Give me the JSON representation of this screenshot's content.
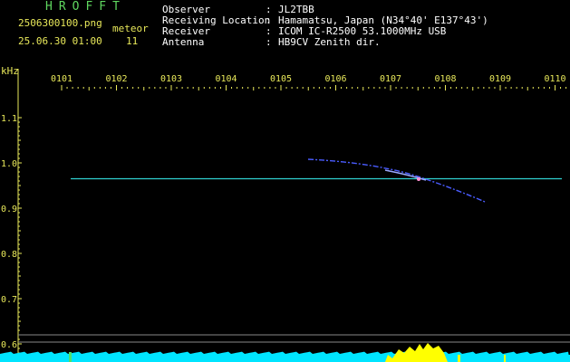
{
  "header": {
    "title": "HROFFT",
    "filename": "2506300100.png",
    "datetime": "25.06.30 01:00",
    "meteor_label": "meteor",
    "meteor_count": "11"
  },
  "info": [
    {
      "label": "Observer",
      "value": "JL2TBB"
    },
    {
      "label": "Receiving Location",
      "value": "Hamamatsu, Japan (N34°40' E137°43')"
    },
    {
      "label": "Receiver",
      "value": "ICOM IC-R2500 53.1000MHz USB"
    },
    {
      "label": "Antenna",
      "value": "HB9CV Zenith dir."
    }
  ],
  "colon": ":",
  "chart_data": {
    "type": "spectrogram",
    "ylabel": "kHz",
    "y_ticks": [
      "1.1",
      "1.0",
      "0.9",
      "0.8",
      "0.7",
      "0.6"
    ],
    "x_ticks": [
      "0101",
      "0102",
      "0103",
      "0104",
      "0105",
      "0106",
      "0107",
      "0108",
      "0109",
      "0110"
    ],
    "carrier_khz": 0.965,
    "colors": {
      "axis": "#e8e85a",
      "carrier": "#2fd0d0",
      "echo": "#4a5cff",
      "noise": "#00e5ff",
      "burst": "#ffff00"
    }
  }
}
